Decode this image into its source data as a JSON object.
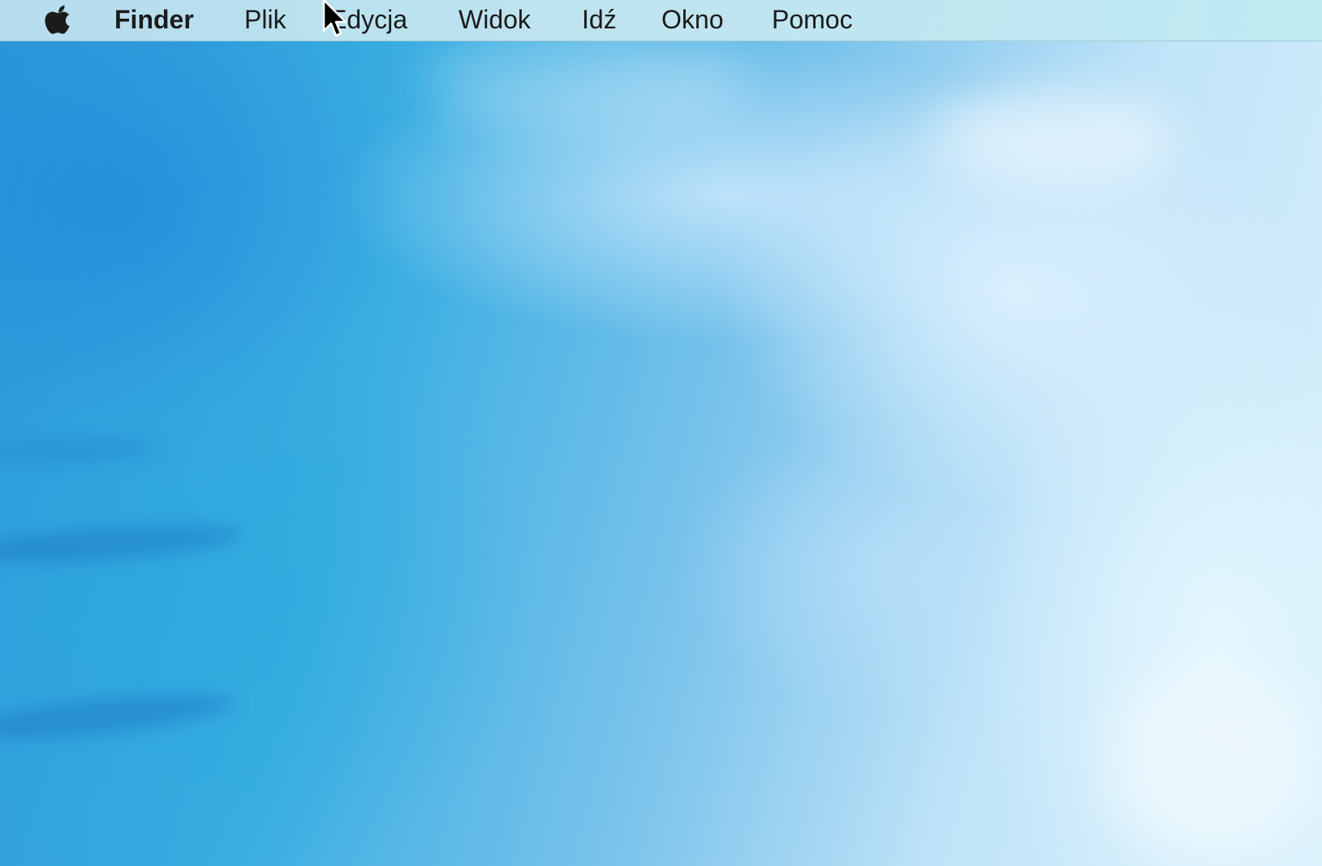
{
  "menubar": {
    "apple_icon": "apple-logo-icon",
    "app_name": "Finder",
    "items": [
      {
        "label": "Plik"
      },
      {
        "label": "Edycja"
      },
      {
        "label": "Widok"
      },
      {
        "label": "Idź"
      },
      {
        "label": "Okno"
      },
      {
        "label": "Pomoc"
      }
    ]
  },
  "desktop": {
    "wallpaper": "blue-water-wallpaper"
  },
  "cursor": {
    "icon": "arrow-cursor-icon"
  },
  "colors": {
    "menubar_bg": "#c3e6f0",
    "menu_text": "#1b1b1b",
    "wallpaper_base": "#3aaee2",
    "wallpaper_light": "#d9f1fb"
  }
}
